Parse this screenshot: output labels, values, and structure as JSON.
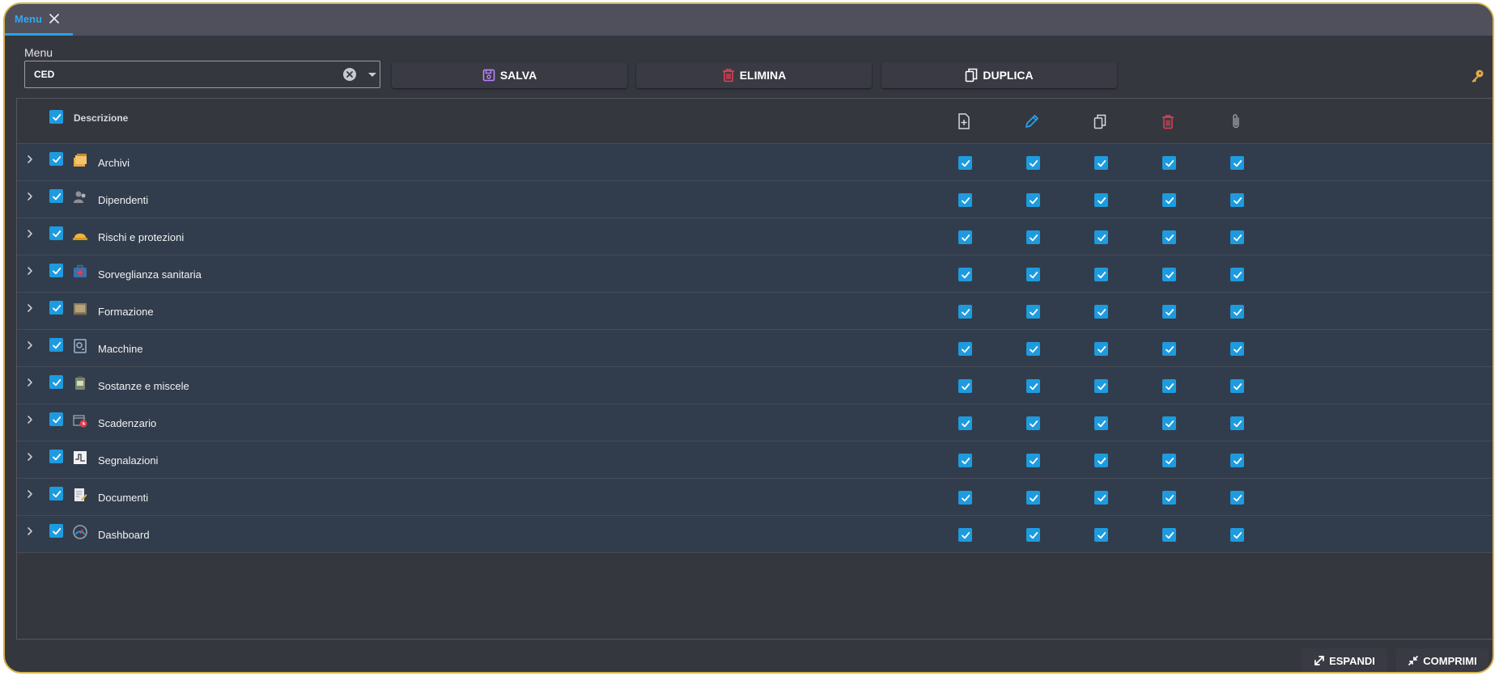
{
  "tab": {
    "label": "Menu"
  },
  "menu_field": {
    "label": "Menu",
    "value": "CED"
  },
  "toolbar": {
    "save_label": "SALVA",
    "delete_label": "ELIMINA",
    "duplicate_label": "DUPLICA"
  },
  "grid": {
    "header_title": "Descrizione",
    "column_icons": [
      "new-document-icon",
      "edit-pencil-icon",
      "copy-icon",
      "trash-icon",
      "paperclip-icon"
    ],
    "rows": [
      {
        "label": "Archivi",
        "icon": "archive-folder-icon"
      },
      {
        "label": "Dipendenti",
        "icon": "employees-icon"
      },
      {
        "label": "Rischi e protezioni",
        "icon": "hard-hat-icon"
      },
      {
        "label": "Sorveglianza sanitaria",
        "icon": "medical-kit-icon"
      },
      {
        "label": "Formazione",
        "icon": "training-board-icon"
      },
      {
        "label": "Macchine",
        "icon": "machine-icon"
      },
      {
        "label": "Sostanze e miscele",
        "icon": "substance-can-icon"
      },
      {
        "label": "Scadenzario",
        "icon": "calendar-clock-icon"
      },
      {
        "label": "Segnalazioni",
        "icon": "report-chart-icon"
      },
      {
        "label": "Documenti",
        "icon": "document-pen-icon"
      },
      {
        "label": "Dashboard",
        "icon": "gauge-icon"
      }
    ]
  },
  "footer": {
    "expand_label": "ESPANDI",
    "collapse_label": "COMPRIMI"
  },
  "colors": {
    "accent": "#1e9bdf",
    "tab_accent": "#26a3e8",
    "row_bg": "#313d4c",
    "save_icon": "#b983ff",
    "delete_icon": "#e04053",
    "edit_icon": "#2aa4ee",
    "window_border": "#d6b24a"
  }
}
